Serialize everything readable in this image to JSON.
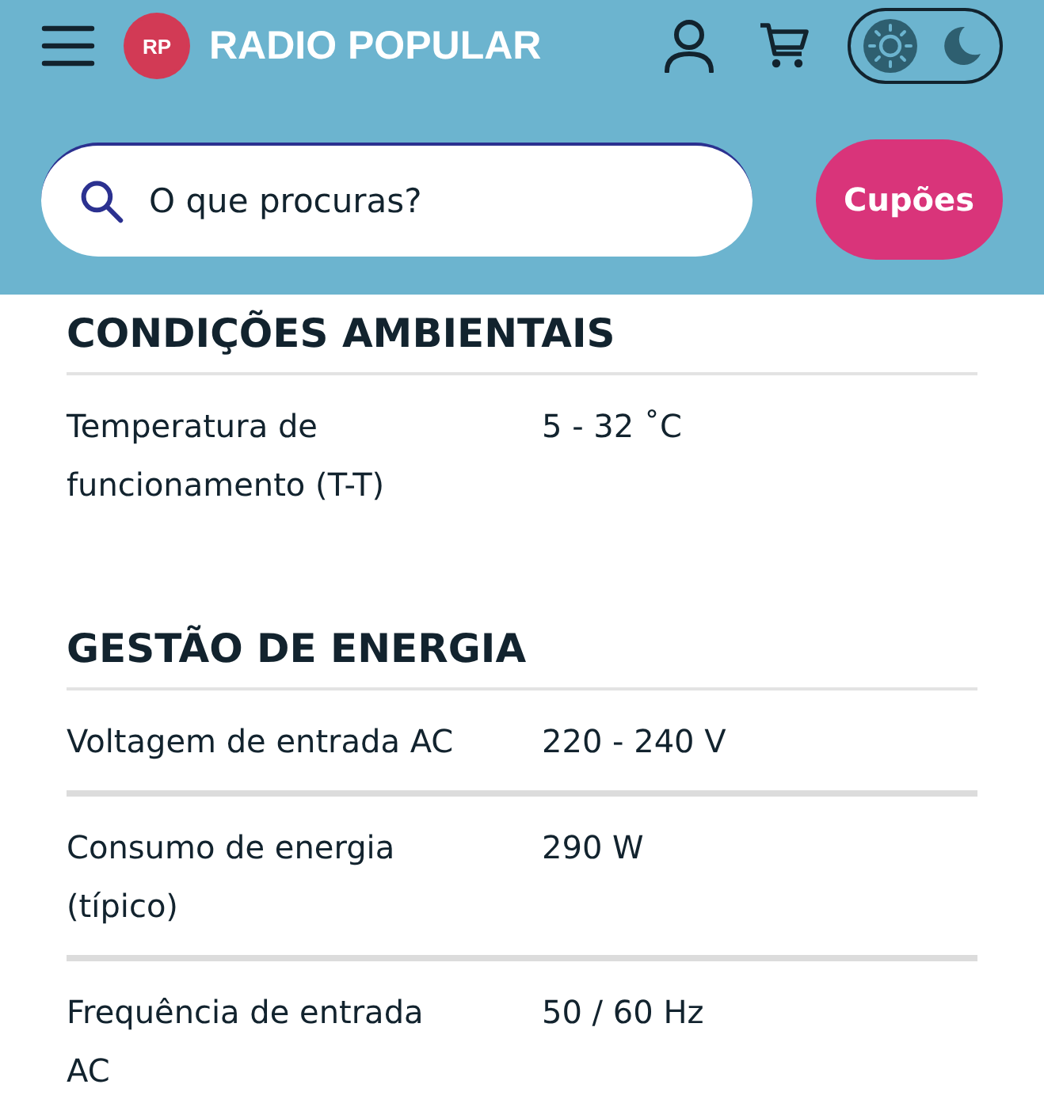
{
  "header": {
    "logo_badge": "RP",
    "brand": "RADIO POPULAR",
    "theme": [
      {
        "kind": "light",
        "selected": true
      },
      {
        "kind": "dark",
        "selected": false
      }
    ]
  },
  "search": {
    "placeholder": "O que procuras?"
  },
  "coupons_button": "Cupões",
  "sections": [
    {
      "title": "CONDIÇÕES AMBIENTAIS",
      "rows": [
        {
          "label": [
            "Temperatura de",
            "funcionamento (T-T)"
          ],
          "value": "5 - 32 ˚C"
        }
      ]
    },
    {
      "title": "GESTÃO DE ENERGIA",
      "rows": [
        {
          "label": [
            "Voltagem de entrada AC"
          ],
          "value": "220 - 240 V"
        },
        {
          "label": [
            "Consumo de energia",
            "(típico)"
          ],
          "value": "290 W"
        },
        {
          "label": [
            "Frequência de entrada",
            "AC"
          ],
          "value": "50 / 60 Hz"
        }
      ]
    }
  ]
}
